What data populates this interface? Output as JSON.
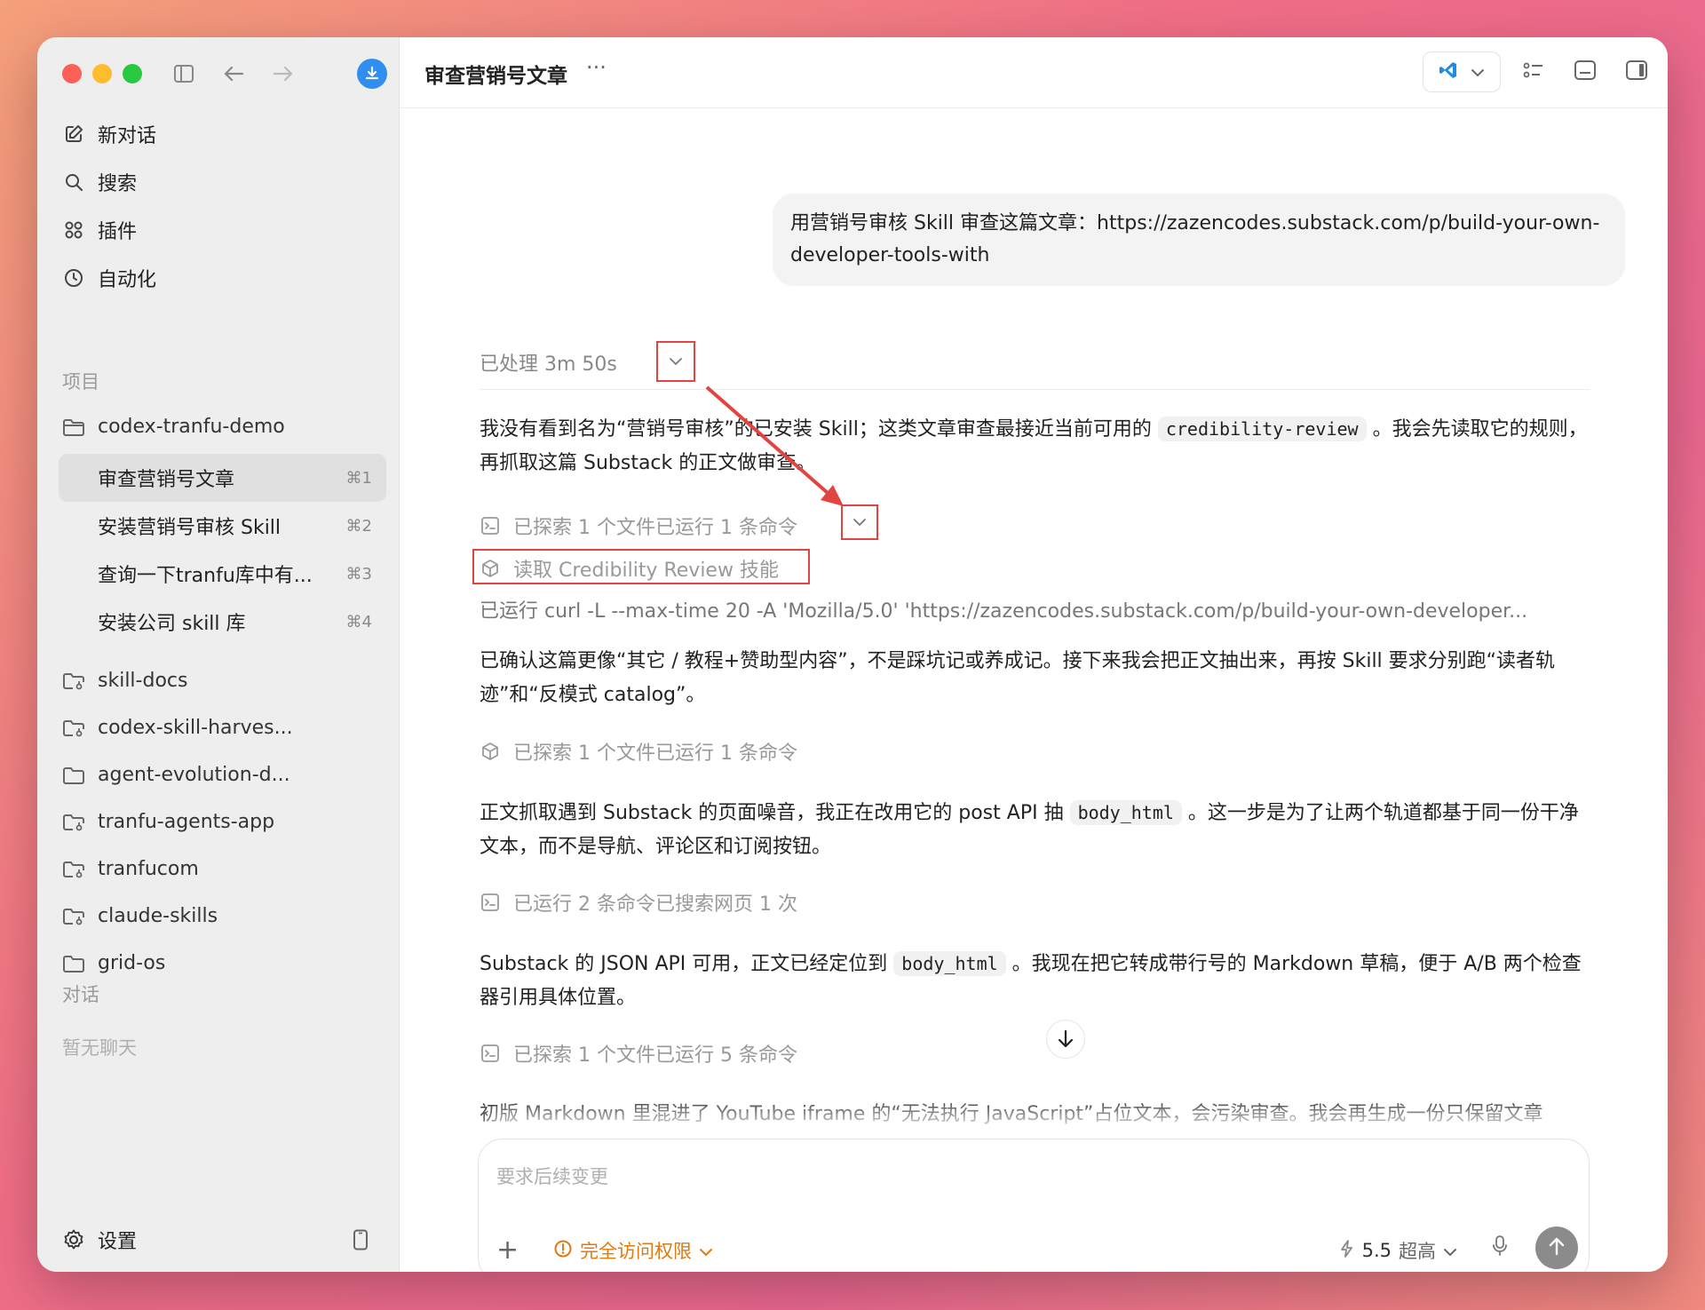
{
  "sidebar": {
    "nav": [
      {
        "label": "新对话",
        "icon": "edit-icon"
      },
      {
        "label": "搜索",
        "icon": "search-icon"
      },
      {
        "label": "插件",
        "icon": "plugins-icon"
      },
      {
        "label": "自动化",
        "icon": "clock-icon"
      }
    ],
    "projects_label": "项目",
    "current_project": "codex-tranfu-demo",
    "chats": [
      {
        "label": "审查营销号文章",
        "shortcut": "⌘1"
      },
      {
        "label": "安装营销号审核 Skill",
        "shortcut": "⌘2"
      },
      {
        "label": "查询一下tranfu库中有...",
        "shortcut": "⌘3"
      },
      {
        "label": "安装公司 skill 库",
        "shortcut": "⌘4"
      }
    ],
    "other_projects": [
      "skill-docs",
      "codex-skill-harves...",
      "agent-evolution-d...",
      "tranfu-agents-app",
      "tranfucom",
      "claude-skills",
      "grid-os"
    ],
    "conversations_label": "对话",
    "no_chats": "暂无聊天",
    "settings_label": "设置"
  },
  "topbar": {
    "title": "审查营销号文章",
    "more": "···"
  },
  "conversation": {
    "user_message": "用营销号审核 Skill 审查这篇文章：https://zazencodes.substack.com/p/build-your-own-developer-tools-with",
    "processed": "已处理 3m 50s",
    "para1_a": "我没有看到名为“营销号审核”的已安装 Skill；这类文章审查最接近当前可用的 ",
    "para1_code": "credibility-review",
    "para1_b": " 。我会先读取它的规则，再抓取这篇 Substack 的正文做审查。",
    "step1": "已探索 1 个文件已运行 1 条命令",
    "step1_read": "读取 Credibility Review 技能",
    "curl": "已运行 curl -L --max-time 20 -A 'Mozilla/5.0' 'https://zazencodes.substack.com/p/build-your-own-developer...",
    "para2": "已确认这篇更像“其它 / 教程+赞助型内容”，不是踩坑记或养成记。接下来我会把正文抽出来，再按 Skill 要求分别跑“读者轨迹”和“反模式 catalog”。",
    "step2": "已探索 1 个文件已运行 1 条命令",
    "para3_a": "正文抓取遇到 Substack 的页面噪音，我正在改用它的 post API 抽 ",
    "para3_code": "body_html",
    "para3_b": " 。这一步是为了让两个轨道都基于同一份干净文本，而不是导航、评论区和订阅按钮。",
    "step3": "已运行 2 条命令已搜索网页 1 次",
    "para4_a": "Substack 的 JSON API 可用，正文已经定位到 ",
    "para4_code": "body_html",
    "para4_b": " 。我现在把它转成带行号的 Markdown 草稿，便于 A/B 两个检查器引用具体位置。",
    "step4": "已探索 1 个文件已运行 5 条命令",
    "para5": "初版 Markdown 里混进了 YouTube iframe 的“无法执行 JavaScript”占位文本，会污染审查。我会再生成一份只保留文章"
  },
  "composer": {
    "placeholder": "要求后续变更",
    "plus": "+",
    "permission": "完全访问权限",
    "model": "5.5",
    "effort": "超高"
  },
  "colors": {
    "accent_blue": "#2f8ef0",
    "permission_orange": "#e07a10",
    "annotation_red": "#e2453f"
  }
}
